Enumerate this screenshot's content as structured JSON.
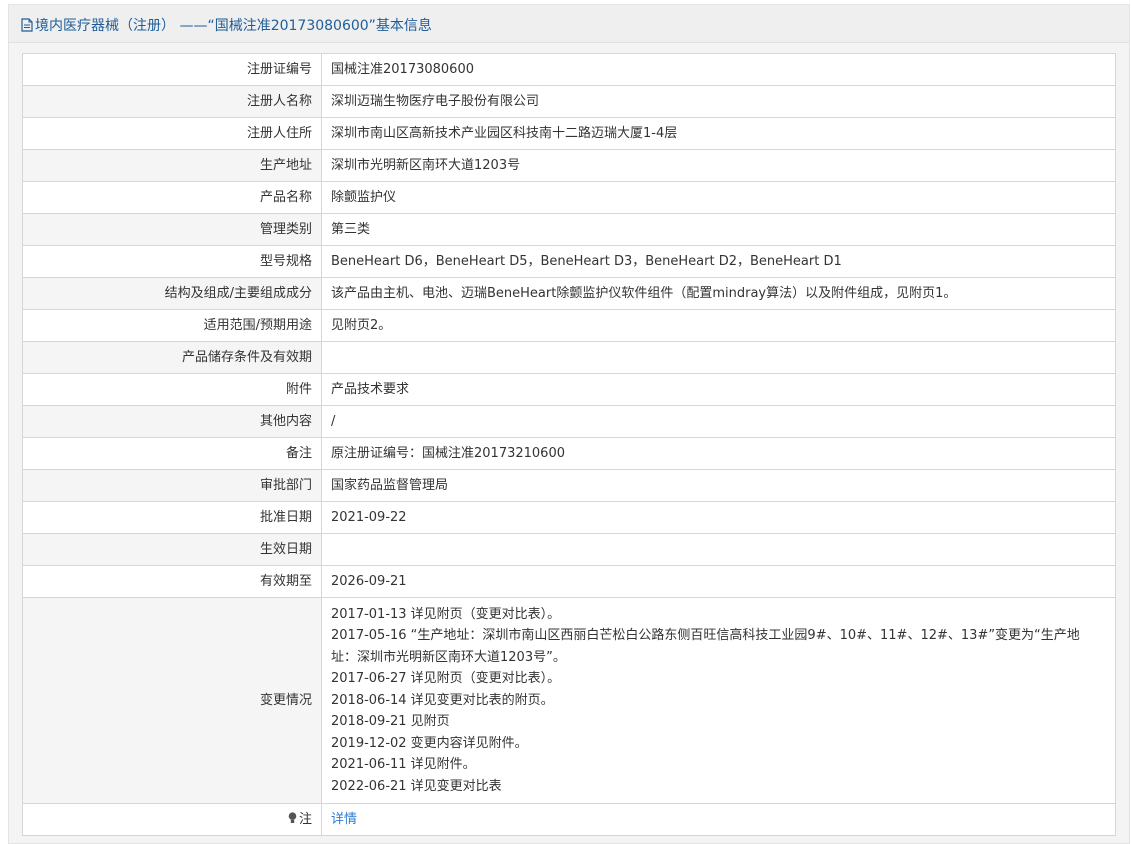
{
  "title": "境内医疗器械（注册） ——“国械注准20173080600”基本信息",
  "rows": [
    {
      "label": "注册证编号",
      "value": "国械注准20173080600"
    },
    {
      "label": "注册人名称",
      "value": "深圳迈瑞生物医疗电子股份有限公司"
    },
    {
      "label": "注册人住所",
      "value": "深圳市南山区高新技术产业园区科技南十二路迈瑞大厦1-4层"
    },
    {
      "label": "生产地址",
      "value": "深圳市光明新区南环大道1203号"
    },
    {
      "label": "产品名称",
      "value": "除颤监护仪"
    },
    {
      "label": "管理类别",
      "value": "第三类"
    },
    {
      "label": "型号规格",
      "value": "BeneHeart D6，BeneHeart D5，BeneHeart D3，BeneHeart D2，BeneHeart D1"
    },
    {
      "label": "结构及组成/主要组成成分",
      "value": "该产品由主机、电池、迈瑞BeneHeart除颤监护仪软件组件（配置mindray算法）以及附件组成，见附页1。"
    },
    {
      "label": "适用范围/预期用途",
      "value": "见附页2。"
    },
    {
      "label": "产品储存条件及有效期",
      "value": ""
    },
    {
      "label": "附件",
      "value": "产品技术要求"
    },
    {
      "label": "其他内容",
      "value": "/"
    },
    {
      "label": "备注",
      "value": "原注册证编号：国械注准20173210600"
    },
    {
      "label": "审批部门",
      "value": "国家药品监督管理局"
    },
    {
      "label": "批准日期",
      "value": "2021-09-22"
    },
    {
      "label": "生效日期",
      "value": ""
    },
    {
      "label": "有效期至",
      "value": "2026-09-21"
    }
  ],
  "changes": {
    "label": "变更情况",
    "lines": [
      "2017-01-13 详见附页（变更对比表）。",
      "2017-05-16 “生产地址：深圳市南山区西丽白芒松白公路东侧百旺信高科技工业园9#、10#、11#、12#、13#”变更为“生产地",
      "址：深圳市光明新区南环大道1203号”。",
      "2017-06-27 详见附页（变更对比表）。",
      "2018-06-14 详见变更对比表的附页。",
      "2018-09-21 见附页",
      "2019-12-02 变更内容详见附件。",
      "2021-06-11 详见附件。",
      "2022-06-21 详见变更对比表"
    ]
  },
  "note": {
    "label": "注",
    "link_text": "详情",
    "icon": "lightbulb-icon"
  },
  "colors": {
    "title": "#1f5e99",
    "link": "#2b7bd4",
    "border": "#d6d6d6",
    "alt_row": "#f5f5f5"
  }
}
